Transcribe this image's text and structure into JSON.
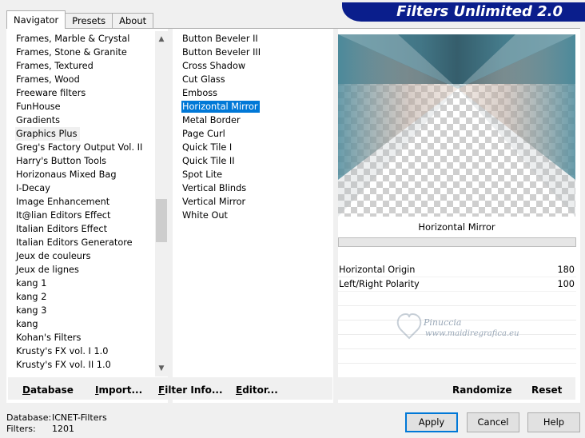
{
  "app": {
    "title": "Filters Unlimited 2.0"
  },
  "tabs": [
    {
      "label": "Navigator"
    },
    {
      "label": "Presets"
    },
    {
      "label": "About"
    }
  ],
  "categories": {
    "selected": "Graphics Plus",
    "items": [
      "Frames, Marble & Crystal",
      "Frames, Stone & Granite",
      "Frames, Textured",
      "Frames, Wood",
      "Freeware filters",
      "FunHouse",
      "Gradients",
      "Graphics Plus",
      "Greg's Factory Output Vol. II",
      "Harry's Button Tools",
      "Horizonaus Mixed Bag",
      "I-Decay",
      "Image Enhancement",
      "It@lian Editors Effect",
      "Italian Editors Effect",
      "Italian Editors Generatore",
      "Jeux de couleurs",
      "Jeux de lignes",
      "kang 1",
      "kang 2",
      "kang 3",
      "kang",
      "Kohan's Filters",
      "Krusty's FX vol. I 1.0",
      "Krusty's FX vol. II 1.0"
    ]
  },
  "filters": {
    "selected": "Horizontal Mirror",
    "items": [
      "Button Beveler II",
      "Button Beveler III",
      "Cross Shadow",
      "Cut Glass",
      "Emboss",
      "Horizontal Mirror",
      "Metal Border",
      "Page Curl",
      "Quick Tile I",
      "Quick Tile II",
      "Spot Lite",
      "Vertical Blinds",
      "Vertical Mirror",
      "White Out"
    ]
  },
  "preview": {
    "filter_name": "Horizontal Mirror"
  },
  "parameters": [
    {
      "name": "Horizontal Origin",
      "value": "180"
    },
    {
      "name": "Left/Right Polarity",
      "value": "100"
    }
  ],
  "watermark": {
    "line1": "Pinuccia",
    "line2": "www.maidiregrafica.eu"
  },
  "toolbar_left": [
    {
      "label": "Database",
      "accel": "D"
    },
    {
      "label": "Import...",
      "accel": "I"
    },
    {
      "label": "Filter Info...",
      "accel": "F"
    },
    {
      "label": "Editor...",
      "accel": "E"
    }
  ],
  "toolbar_right": [
    {
      "label": "Randomize"
    },
    {
      "label": "Reset"
    }
  ],
  "status": {
    "database_label": "Database:",
    "database_value": "ICNET-Filters",
    "filters_label": "Filters:",
    "filters_value": "1201"
  },
  "buttons": {
    "apply": "Apply",
    "cancel": "Cancel",
    "help": "Help"
  },
  "colors": {
    "banner": "#0a1e8c",
    "selection": "#0078d7",
    "default_button_border": "#0078d7"
  }
}
